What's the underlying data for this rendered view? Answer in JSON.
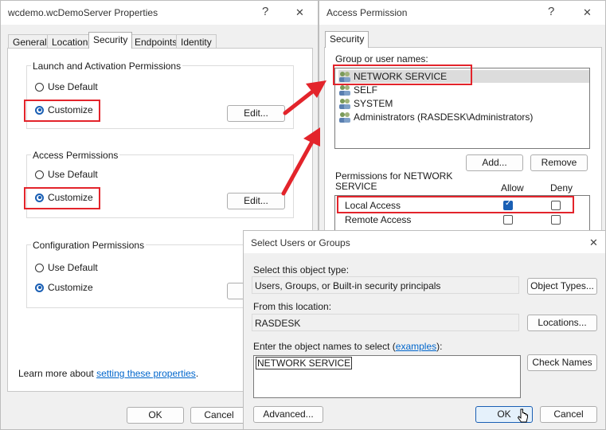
{
  "props_window": {
    "title": "wcdemo.wcDemoServer Properties",
    "help": "?",
    "close": "✕",
    "tabs": [
      "General",
      "Location",
      "Security",
      "Endpoints",
      "Identity"
    ],
    "launch": {
      "label": "Launch and Activation Permissions",
      "use_default": "Use Default",
      "customize": "Customize",
      "edit": "Edit..."
    },
    "access": {
      "label": "Access Permissions",
      "use_default": "Use Default",
      "customize": "Customize",
      "edit": "Edit..."
    },
    "config": {
      "label": "Configuration Permissions",
      "use_default": "Use Default",
      "customize": "Customize"
    },
    "learn_prefix": "Learn more about ",
    "learn_link": "setting these properties",
    "learn_suffix": ".",
    "ok": "OK",
    "cancel": "Cancel"
  },
  "access_window": {
    "title": "Access Permission",
    "help": "?",
    "close": "✕",
    "tab": "Security",
    "group_label": "Group or user names:",
    "users": [
      "NETWORK SERVICE",
      "SELF",
      "SYSTEM",
      "Administrators (RASDESK\\Administrators)"
    ],
    "add": "Add...",
    "remove": "Remove",
    "perms_label": "Permissions for NETWORK SERVICE",
    "allow": "Allow",
    "deny": "Deny",
    "perms": [
      {
        "name": "Local Access",
        "allow": true,
        "deny": false
      },
      {
        "name": "Remote Access",
        "allow": false,
        "deny": false
      }
    ]
  },
  "select_window": {
    "title": "Select Users or Groups",
    "close": "✕",
    "type_label": "Select this object type:",
    "type_value": "Users, Groups, or Built-in security principals",
    "object_types": "Object Types...",
    "location_label": "From this location:",
    "location_value": "RASDESK",
    "locations": "Locations...",
    "enter_prefix": "Enter the object names to select (",
    "enter_link": "examples",
    "enter_suffix": "):",
    "names_value": "NETWORK SERVICE",
    "check_names": "Check Names",
    "advanced": "Advanced...",
    "ok": "OK",
    "cancel": "Cancel"
  },
  "colors": {
    "highlight": "#e3242b",
    "accent": "#1a5fb4"
  }
}
